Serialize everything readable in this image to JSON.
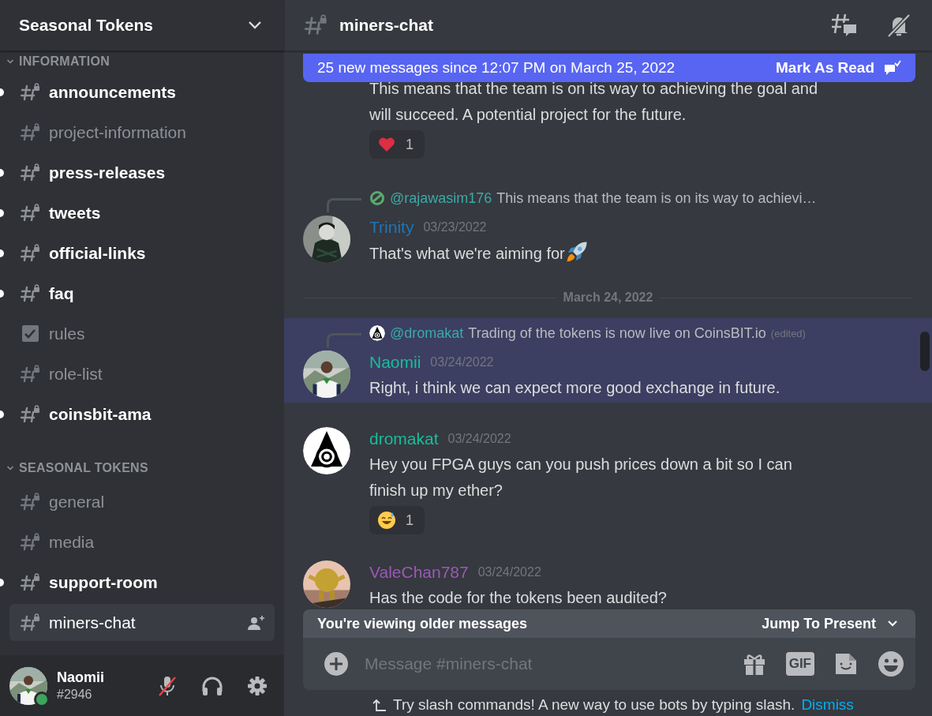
{
  "server": {
    "name": "Seasonal Tokens"
  },
  "categories": [
    {
      "name": "INFORMATION",
      "expanded": true,
      "channels": [
        {
          "name": "announcements",
          "kind": "text",
          "unread": true,
          "selected": false
        },
        {
          "name": "project-information",
          "kind": "text",
          "unread": false,
          "selected": false
        },
        {
          "name": "press-releases",
          "kind": "text",
          "unread": true,
          "selected": false
        },
        {
          "name": "tweets",
          "kind": "text",
          "unread": true,
          "selected": false
        },
        {
          "name": "official-links",
          "kind": "text",
          "unread": true,
          "selected": false
        },
        {
          "name": "faq",
          "kind": "text",
          "unread": true,
          "selected": false
        },
        {
          "name": "rules",
          "kind": "rules",
          "unread": false,
          "selected": false
        },
        {
          "name": "role-list",
          "kind": "text",
          "unread": false,
          "selected": false
        },
        {
          "name": "coinsbit-ama",
          "kind": "text",
          "unread": true,
          "selected": false
        }
      ]
    },
    {
      "name": "SEASONAL TOKENS",
      "expanded": true,
      "channels": [
        {
          "name": "general",
          "kind": "text",
          "unread": false,
          "selected": false
        },
        {
          "name": "media",
          "kind": "text",
          "unread": false,
          "selected": false
        },
        {
          "name": "support-room",
          "kind": "text",
          "unread": true,
          "selected": false
        },
        {
          "name": "miners-chat",
          "kind": "text",
          "unread": false,
          "selected": true
        }
      ]
    }
  ],
  "user_panel": {
    "name": "Naomii",
    "tag": "#2946",
    "online": true,
    "mic_muted": true
  },
  "channel_header": {
    "name": "miners-chat"
  },
  "new_messages_banner": {
    "text": "25 new messages since 12:07 PM on March 25, 2022",
    "action": "Mark As Read"
  },
  "messages": [
    {
      "kind": "continuation",
      "text": "This means that the team is on its way to achieving the goal and will succeed. A potential project for the future.",
      "highlighted": false,
      "reactions": [
        {
          "kind": "heart",
          "count": "1"
        }
      ]
    },
    {
      "kind": "full",
      "author": "Trinity",
      "color": "#1f74b8",
      "avatar": {
        "kind": "dark"
      },
      "timestamp": "03/23/2022",
      "text": "That's what we're aiming for",
      "trailing_emoji": {
        "kind": "rocket"
      },
      "highlighted": false,
      "reply": {
        "avatar": {
          "kind": "letter"
        },
        "mention": "@rajawasim176",
        "text": "This means that the team is on its way to achievi…"
      }
    },
    {
      "kind": "divider",
      "text": "March 24, 2022"
    },
    {
      "kind": "full",
      "author": "Naomii",
      "color": "#1abc9c",
      "avatar": {
        "kind": "green"
      },
      "timestamp": "03/24/2022",
      "text": "Right, i think we can expect more good exchange in future.",
      "highlighted": true,
      "reply": {
        "avatar": {
          "kind": "target"
        },
        "mention": "@dromakat",
        "text": "Trading of the tokens is now live on CoinsBIT.io",
        "edited": true,
        "edited_label": "(edited)"
      }
    },
    {
      "kind": "full",
      "author": "dromakat",
      "color": "#1abc9c",
      "avatar": {
        "kind": "target"
      },
      "timestamp": "03/24/2022",
      "text": "Hey you FPGA guys can you push prices down a bit so I can finish up my ether?",
      "highlighted": false,
      "reactions": [
        {
          "kind": "sweat-smile",
          "count": "1"
        }
      ]
    },
    {
      "kind": "full",
      "author": "ValeChan787",
      "color": "#9b59b6",
      "avatar": {
        "kind": "toy"
      },
      "timestamp": "03/24/2022",
      "text": "Has the code for the tokens been audited?",
      "highlighted": false
    }
  ],
  "older_messages_bar": {
    "text": "You're viewing older messages",
    "action": "Jump To Present"
  },
  "composer": {
    "placeholder": "Message #miners-chat",
    "gif_label": "GIF"
  },
  "tip": {
    "text": "Try slash commands! A new way to use bots by typing slash.",
    "link": "Dismiss"
  }
}
